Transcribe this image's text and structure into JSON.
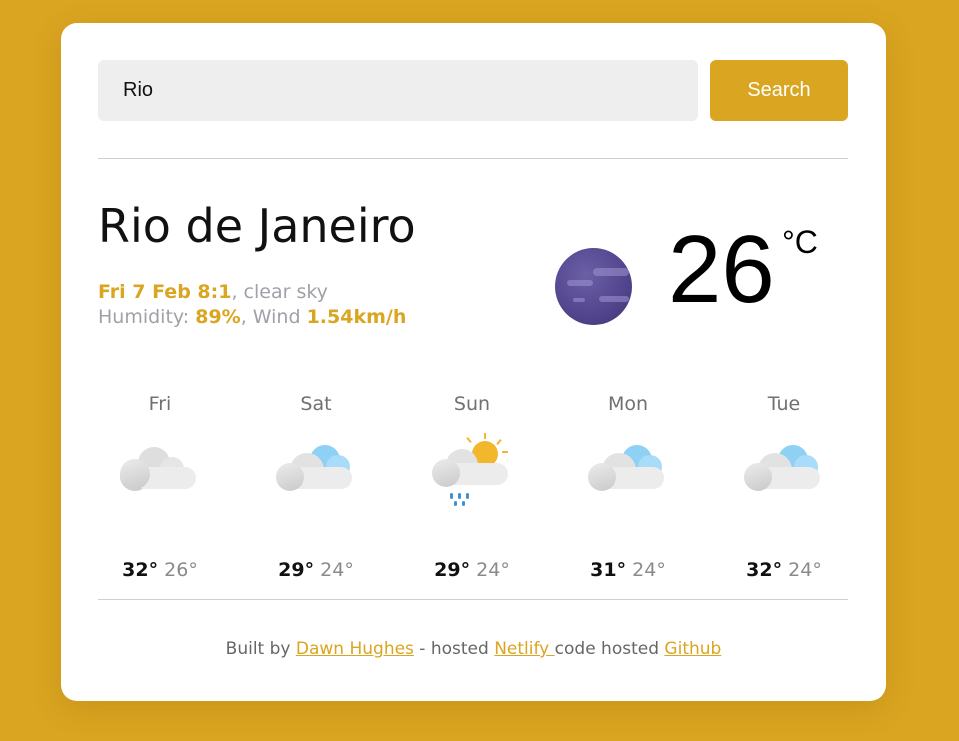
{
  "search": {
    "value": "Rio",
    "button_label": "Search"
  },
  "current": {
    "city": "Rio de Janeiro",
    "datetime": "Fri 7 Feb 8:1",
    "description": ", clear sky",
    "humidity_label": "Humidity: ",
    "humidity_value": "89%",
    "wind_label": ", Wind ",
    "wind_value": "1.54km/h",
    "temperature": "26",
    "unit": "°C",
    "icon": "moon-icon"
  },
  "forecast": [
    {
      "day": "Fri",
      "icon": "cloud-icon",
      "high": "32°",
      "low": "26°"
    },
    {
      "day": "Sat",
      "icon": "cloud-icon",
      "high": "29°",
      "low": "24°"
    },
    {
      "day": "Sun",
      "icon": "sun-rain-cloud-icon",
      "high": "29°",
      "low": "24°"
    },
    {
      "day": "Mon",
      "icon": "cloud-icon",
      "high": "31°",
      "low": "24°"
    },
    {
      "day": "Tue",
      "icon": "cloud-icon",
      "high": "32°",
      "low": "24°"
    }
  ],
  "footer": {
    "built_by": "Built by ",
    "author": "Dawn Hughes",
    "hosted_text": " - hosted ",
    "host": "Netlify ",
    "code_text": "code hosted ",
    "repo": "Github"
  },
  "colors": {
    "accent": "#daa520",
    "background": "#daa520",
    "card": "#ffffff"
  }
}
